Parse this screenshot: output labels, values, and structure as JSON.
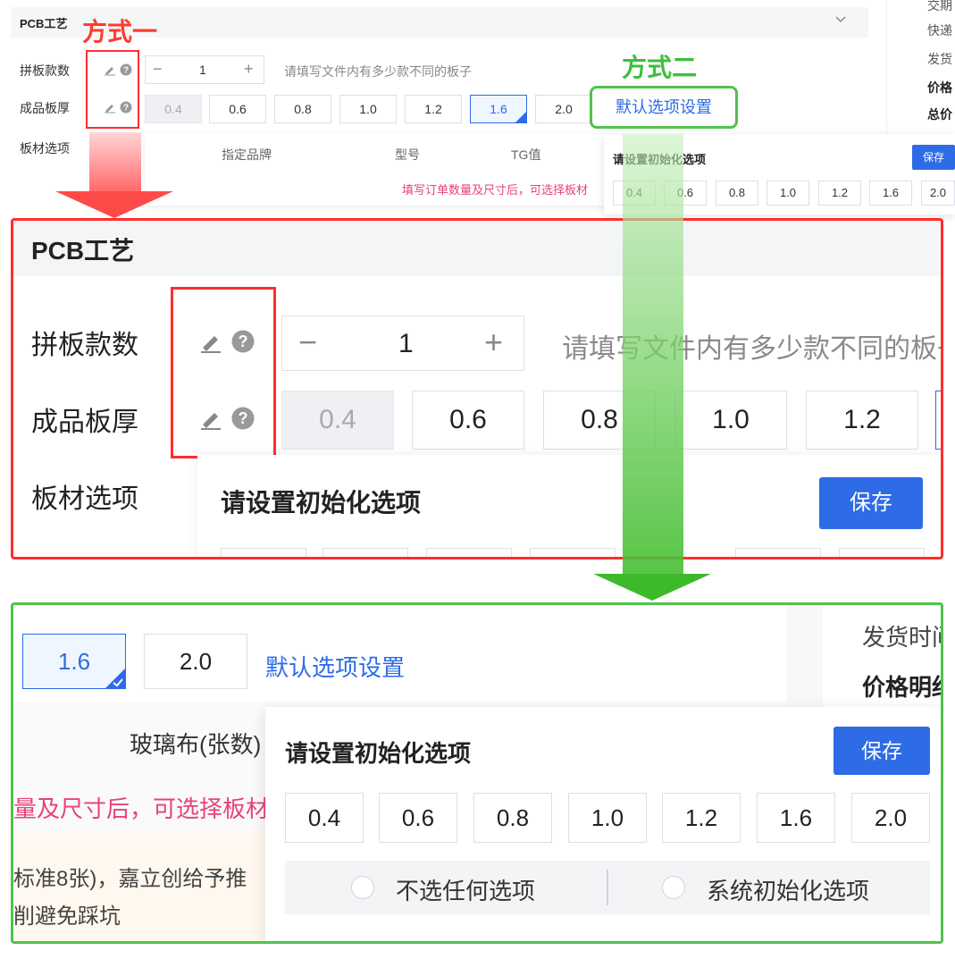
{
  "annotations": {
    "method_one": "方式一",
    "method_two": "方式二"
  },
  "pcb": {
    "title": "PCB工艺",
    "panel_count_label": "拼板款数",
    "panel_count_value": "1",
    "panel_count_hint": "请填写文件内有多少款不同的板子",
    "panel_count_hint_clipped": "请填写文件内有多少款不同的板子",
    "minus": "−",
    "plus": "+",
    "thickness_label": "成品板厚",
    "thickness_options": [
      "0.4",
      "0.6",
      "0.8",
      "1.0",
      "1.2",
      "1.6",
      "2.0"
    ],
    "thickness_disabled": "0.4",
    "thickness_selected": "1.6",
    "default_settings_link": "默认选项设置",
    "material_label": "板材选项",
    "material_columns": [
      "指定品牌",
      "型号",
      "TG值"
    ],
    "material_hint": "填写订单数量及尺寸后，可选择板材",
    "side_panel": [
      "交期",
      "快递",
      "发货",
      "价格",
      "总价"
    ]
  },
  "init_popup": {
    "title": "请设置初始化选项",
    "save": "保存",
    "options": [
      "0.4",
      "0.6",
      "0.8",
      "1.0",
      "1.2",
      "1.6",
      "2.0"
    ],
    "radio_none": "不选任何选项",
    "radio_system": "系统初始化选项"
  },
  "green_detail": {
    "glass_cloth": "玻璃布(张数)",
    "pink_hint": "量及尺寸后，可选择板材",
    "cream_line1": "标准8张)，嘉立创给予推",
    "cream_line2": "削避免踩坑",
    "side_delivery": "发货时间",
    "side_price": "价格明细"
  },
  "colors": {
    "primary_blue": "#2e6be6",
    "annotation_red": "#ff2d2d",
    "annotation_green": "#52c24a",
    "hint_pink": "#e6437a"
  }
}
